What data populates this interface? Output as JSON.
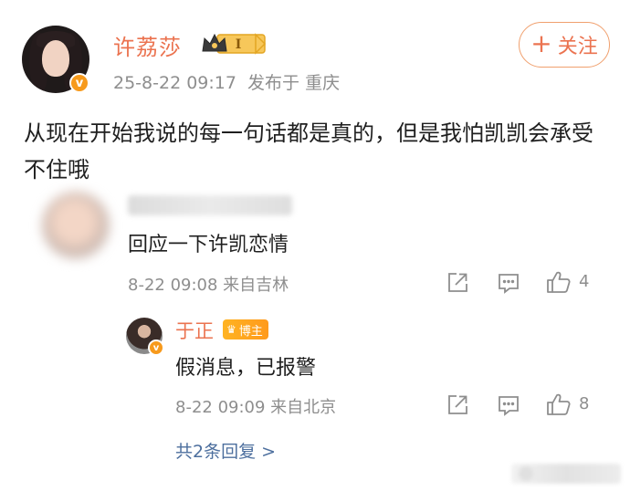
{
  "post": {
    "username": "许荔莎",
    "level": "I",
    "time": "25-8-22 09:17  发布于 重庆",
    "follow_label": "关注",
    "text": "从现在开始我说的每一句话都是真的，但是我怕凯凯会承受不住哦"
  },
  "comment": {
    "text": "回应一下许凯恋情",
    "meta": "8-22 09:08 来自吉林",
    "like_count": "4"
  },
  "reply": {
    "username": "于正",
    "badge": "博主",
    "text": "假消息，已报警",
    "meta": "8-22 09:09 来自北京",
    "like_count": "8"
  },
  "more_replies": "共2条回复 >",
  "colors": {
    "accent": "#eb7350",
    "link": "#4d6f9e",
    "meta": "#8e8e8e",
    "badge": "#f79a1c"
  },
  "icons": [
    "verified-v-icon",
    "crown-level-icon",
    "share-icon",
    "comment-icon",
    "like-icon"
  ]
}
